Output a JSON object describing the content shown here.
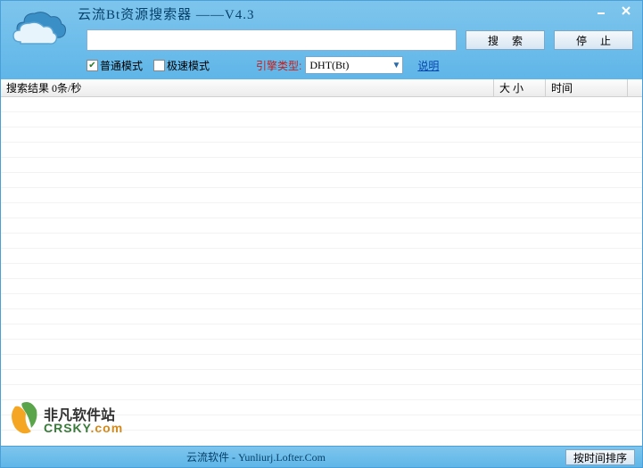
{
  "titlebar": {
    "title": "云流Bt资源搜索器 ——V4.3"
  },
  "search": {
    "value": "",
    "placeholder": "",
    "search_label": "搜 索",
    "stop_label": "停 止"
  },
  "options": {
    "normal_mode_label": "普通模式",
    "fast_mode_label": "极速模式",
    "engine_label": "引擎类型:",
    "engine_value": "DHT(Bt)",
    "help_label": "说明"
  },
  "results": {
    "col_name": "搜索结果 0条/秒",
    "col_size": "大 小",
    "col_time": "时间"
  },
  "statusbar": {
    "brand": "云流软件 - Yunliurj.Lofter.Com",
    "sort_label": "按时间排序"
  },
  "watermark": {
    "line1": "非凡软件站",
    "line2_a": "CRSKY",
    "line2_b": ".com"
  }
}
